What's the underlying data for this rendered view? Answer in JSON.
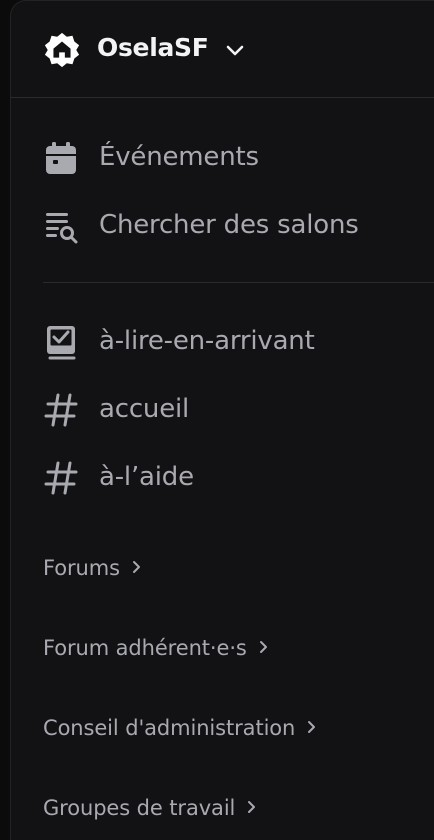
{
  "server": {
    "name": "OselaSF",
    "icon": "home-icon"
  },
  "top_items": [
    {
      "label": "Événements",
      "icon": "calendar-icon"
    },
    {
      "label": "Chercher des salons",
      "icon": "browse-channels-icon"
    }
  ],
  "channels": [
    {
      "label": "à-lire-en-arrivant",
      "icon": "rules-channel-icon"
    },
    {
      "label": "accueil",
      "icon": "hash-icon"
    },
    {
      "label": "à-l’aide",
      "icon": "hash-icon"
    }
  ],
  "categories": [
    {
      "label": "Forums"
    },
    {
      "label": "Forum adhérent·e·s"
    },
    {
      "label": "Conseil d'administration"
    },
    {
      "label": "Groupes de travail"
    }
  ],
  "colors": {
    "background": "#121214",
    "text_primary": "#f2f3f5",
    "text_muted": "#a8aab0",
    "divider": "#2a2a2e"
  }
}
